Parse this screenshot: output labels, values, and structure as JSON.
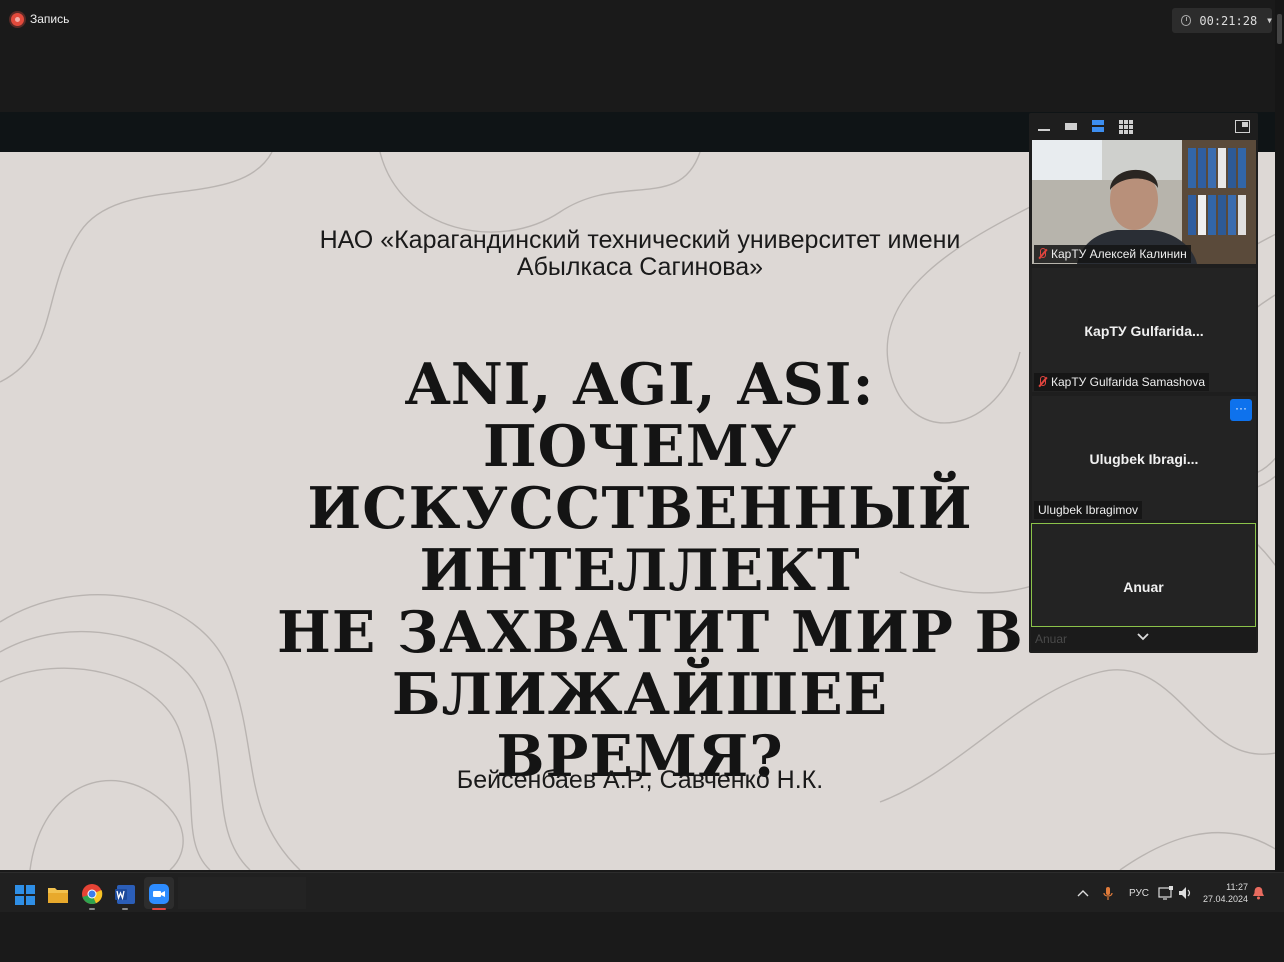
{
  "recording": {
    "label": "Запись"
  },
  "timer": {
    "value": "00:21:28"
  },
  "slide": {
    "org_line1": "НАО «Карагандинский технический университет имени",
    "org_line2": "Абылкаса Сагинова»",
    "title_lines": [
      "ANI, AGI, ASI: ПОЧЕМУ",
      "ИСКУССТВЕННЫЙ",
      "ИНТЕЛЛЕКТ",
      " НЕ ЗАХВАТИТ МИР В",
      "БЛИЖАЙШЕЕ ВРЕМЯ?"
    ],
    "authors": "Бейсенбаев А.Р., Савченко Н.К."
  },
  "participants": [
    {
      "label": "КарТУ Алексей Калинин",
      "muted": true,
      "has_video": true
    },
    {
      "display": "КарТУ  Gulfarida...",
      "label": "КарТУ Gulfarida Samashova",
      "muted": true
    },
    {
      "display": "Ulugbek  Ibragi...",
      "label": "Ulugbek Ibragimov",
      "muted": false
    },
    {
      "display": "Anuar",
      "label": "Anuar",
      "muted": false,
      "active": true
    }
  ],
  "more_button": "···",
  "taskbar": {
    "lang": "РУС",
    "time": "11:27",
    "date": "27.04.2024"
  },
  "colors": {
    "accent": "#0e72ed",
    "active_border": "#8bc34a",
    "mute": "#e0443e",
    "slide_bg": "#ddd8d5"
  }
}
